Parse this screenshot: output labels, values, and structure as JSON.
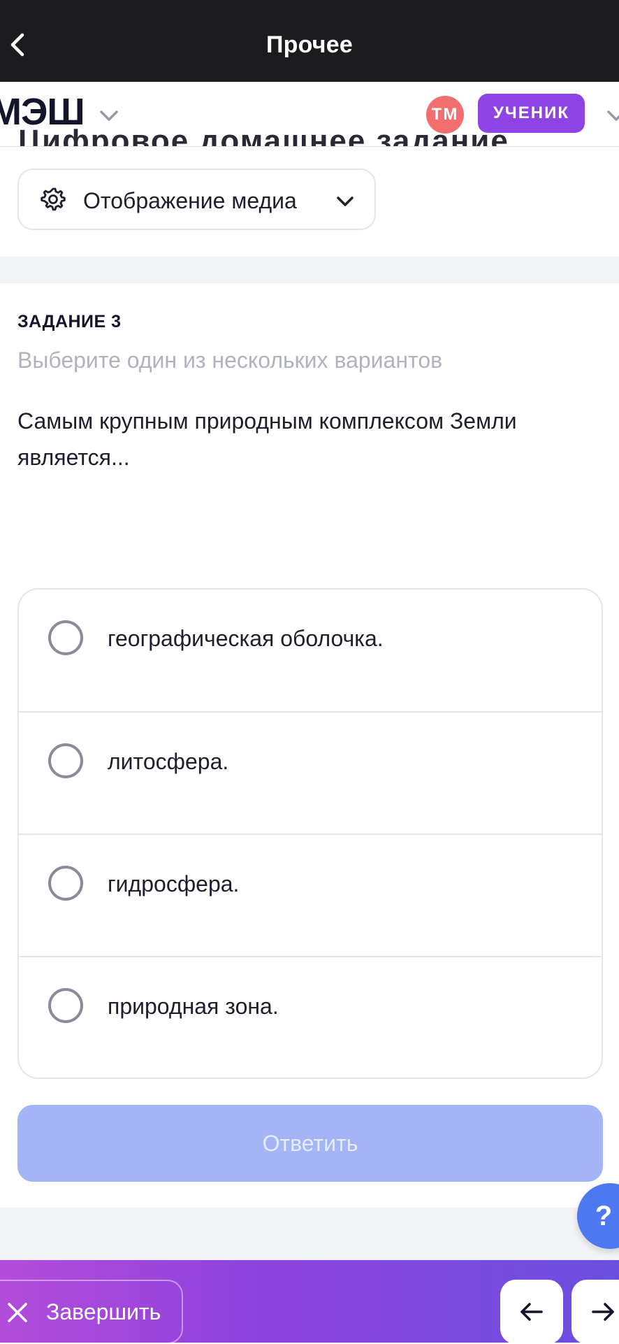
{
  "topbar": {
    "title": "Прочее"
  },
  "app_header": {
    "logo": "МЭШ",
    "avatar_initials": "ТМ",
    "role": "УЧЕНИК",
    "partially_hidden_title": "Цифровое домашнее задание"
  },
  "media_toggle": {
    "label": "Отображение медиа"
  },
  "task": {
    "label": "ЗАДАНИЕ 3",
    "hint": "Выберите один из нескольких вариантов",
    "question": "Самым крупным природным комплексом Земли является...",
    "options": [
      {
        "label": "географическая оболочка.",
        "selected": false
      },
      {
        "label": "литосфера.",
        "selected": false
      },
      {
        "label": "гидросфера.",
        "selected": false
      },
      {
        "label": "природная зона.",
        "selected": false
      }
    ],
    "answer_button": "Ответить"
  },
  "help": {
    "label": "?"
  },
  "bottom": {
    "finish_label": "Завершить"
  },
  "colors": {
    "topbar_bg": "#1c1c1f",
    "role_badge": "#8d44e2",
    "avatar": "#f36e6e",
    "answer_disabled": "#a4b5f7",
    "help": "#4e78ef",
    "bottom_gradient_start": "#b34cda",
    "bottom_gradient_end": "#6a4fde"
  },
  "icons": [
    "chevron-left-icon",
    "chevron-down-icon",
    "gear-icon",
    "close-icon",
    "arrow-left-icon",
    "arrow-right-icon",
    "question-icon"
  ]
}
